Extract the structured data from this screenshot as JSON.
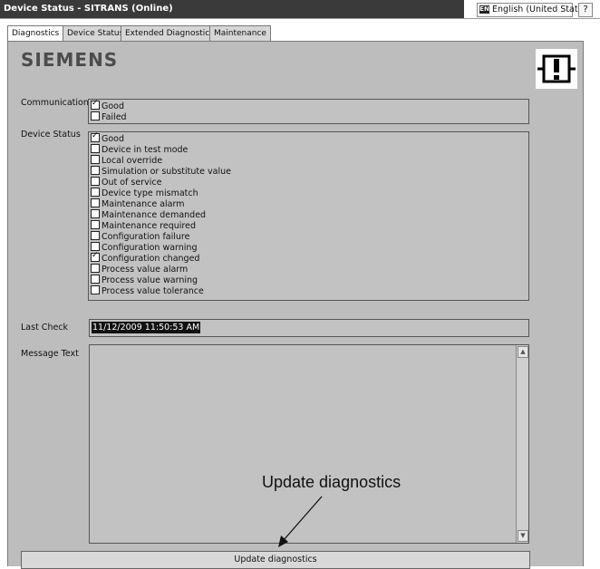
{
  "window": {
    "title": "Device Status - SITRANS  (Online)",
    "language_badge": "EN",
    "language_label": "English (United States)",
    "help_label": "?"
  },
  "tabs": [
    {
      "label": "Diagnostics",
      "active": true
    },
    {
      "label": "Device Status",
      "active": false
    },
    {
      "label": "Extended Diagnostics",
      "active": false
    },
    {
      "label": "Maintenance",
      "active": false
    }
  ],
  "logo_text": "SIEMENS",
  "communication": {
    "label": "Communication",
    "items": [
      {
        "label": "Good",
        "checked": true
      },
      {
        "label": "Failed",
        "checked": false
      }
    ]
  },
  "device_status": {
    "label": "Device Status",
    "items": [
      {
        "label": "Good",
        "checked": true
      },
      {
        "label": "Device in test mode",
        "checked": false
      },
      {
        "label": "Local override",
        "checked": false
      },
      {
        "label": "Simulation or substitute value",
        "checked": false
      },
      {
        "label": "Out of service",
        "checked": false
      },
      {
        "label": "Device type mismatch",
        "checked": false
      },
      {
        "label": "Maintenance alarm",
        "checked": false
      },
      {
        "label": "Maintenance demanded",
        "checked": false
      },
      {
        "label": "Maintenance required",
        "checked": false
      },
      {
        "label": "Configuration failure",
        "checked": false
      },
      {
        "label": "Configuration warning",
        "checked": false
      },
      {
        "label": "Configuration changed",
        "checked": true
      },
      {
        "label": "Process value alarm",
        "checked": false
      },
      {
        "label": "Process value warning",
        "checked": false
      },
      {
        "label": "Process value tolerance",
        "checked": false
      }
    ]
  },
  "last_check": {
    "label": "Last Check",
    "value": "11/12/2009 11:50:53 AM"
  },
  "message_text": {
    "label": "Message Text",
    "value": ""
  },
  "callout": "Update diagnostics",
  "update_button": "Update diagnostics"
}
